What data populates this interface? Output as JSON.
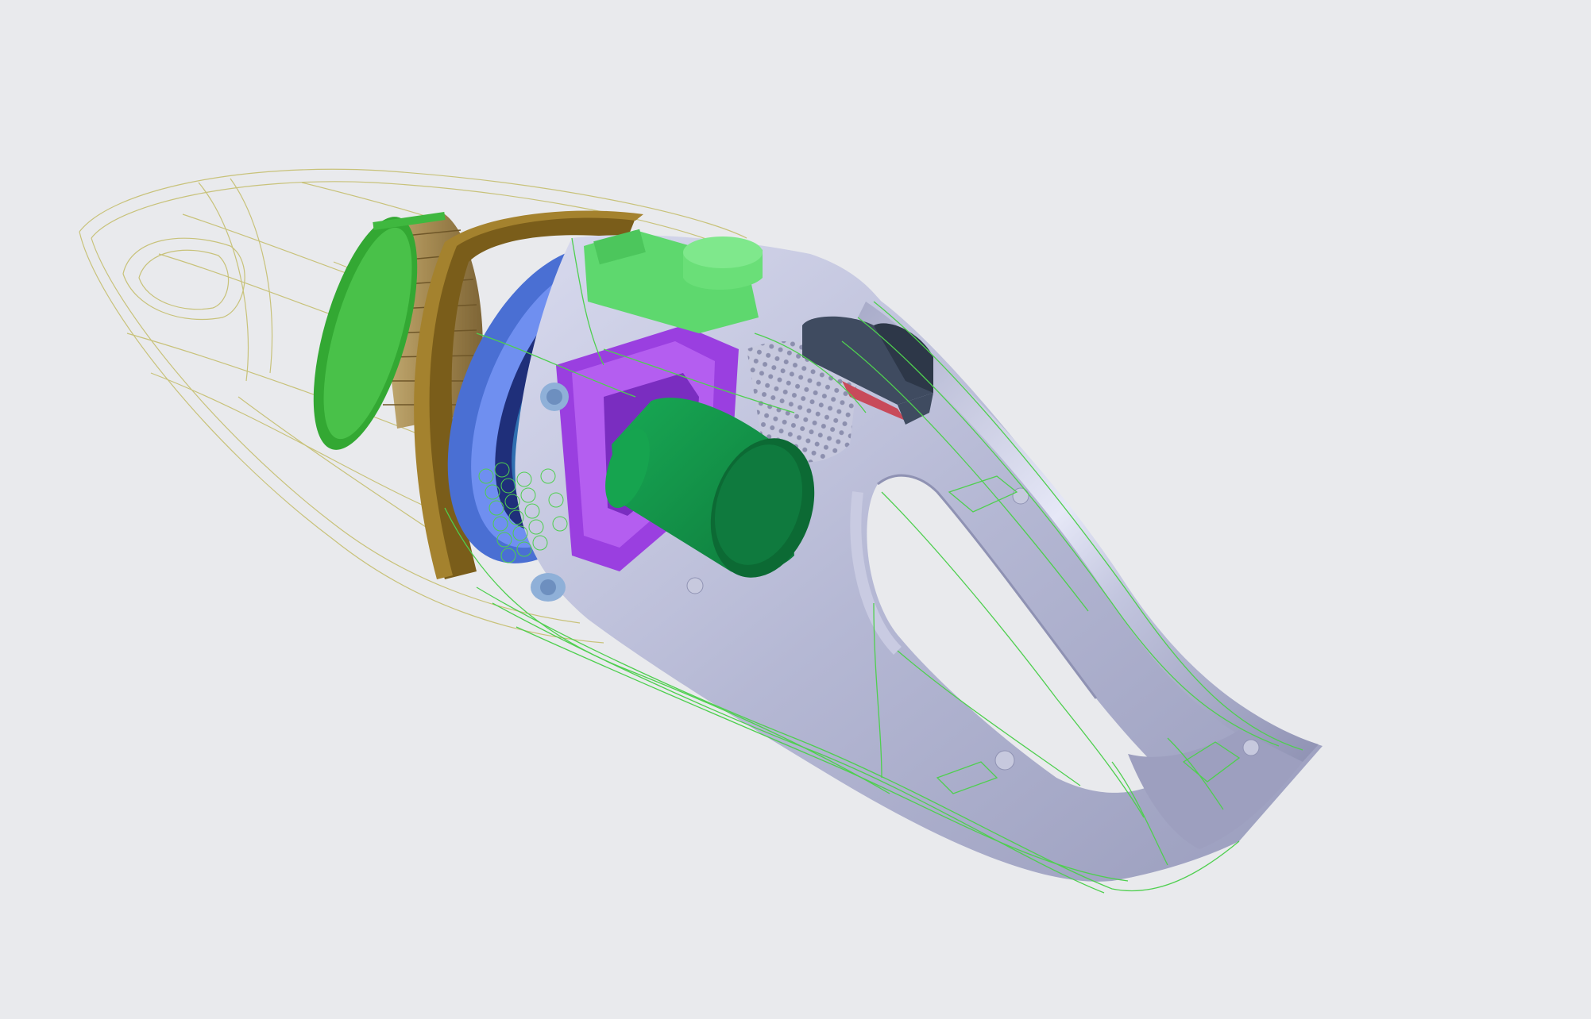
{
  "scene": {
    "colors": {
      "background": "#e9eaed",
      "housing": "#b9bbd6",
      "housing_light": "#dcdef0",
      "housing_shadow": "#8f92b3",
      "wire_green": "#4fcf4f",
      "wire_yellow": "#c8c27a",
      "filter_green": "#3fb83f",
      "filter_tan": "#a89060",
      "flange_brown": "#8a6a20",
      "disc_blue": "#5b7fe0",
      "motor_purple": "#a24de6",
      "motor_green": "#13984a",
      "motor_green_dark": "#0c6a34",
      "pcb_green": "#5ed86e",
      "switch_dark": "#3f4b60",
      "switch_red": "#c84a5a"
    },
    "parts": [
      "transparent-nozzle-shell",
      "dust-filter",
      "filter-flange",
      "sealing-disc",
      "motor-mount",
      "motor",
      "circuit-board",
      "power-switch",
      "vent-grille",
      "handle-housing",
      "screw-bosses",
      "wireframe-shell"
    ]
  }
}
